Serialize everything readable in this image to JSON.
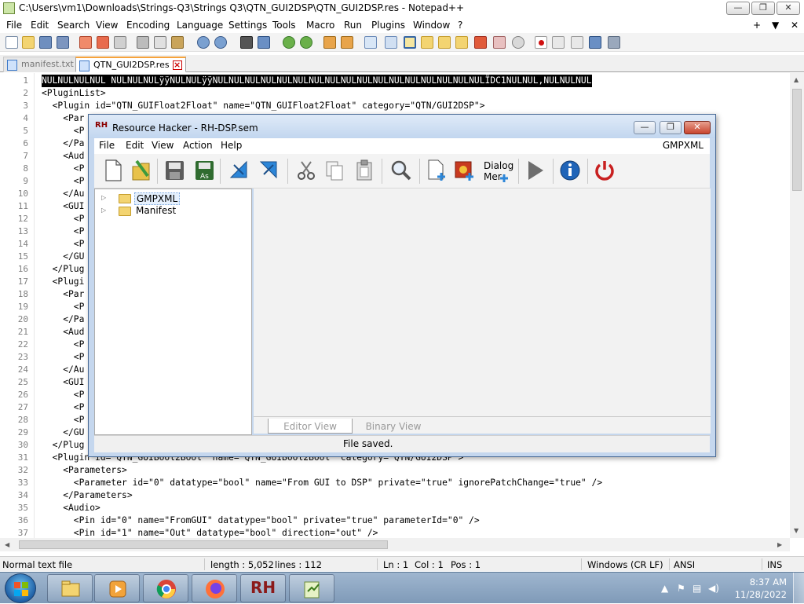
{
  "npp": {
    "title": "C:\\Users\\vm1\\Downloads\\Strings-Q3\\Strings Q3\\QTN_GUI2DSP\\QTN_GUI2DSP.res - Notepad++",
    "menu": [
      "File",
      "Edit",
      "Search",
      "View",
      "Encoding",
      "Language",
      "Settings",
      "Tools",
      "Macro",
      "Run",
      "Plugins",
      "Window",
      "?"
    ],
    "menu_right": [
      "+",
      "▼",
      "✕"
    ],
    "caption": {
      "minimize": "—",
      "maximize": "❐",
      "close": "✕"
    },
    "tabs": [
      {
        "label": "manifest.txt",
        "active": false
      },
      {
        "label": "QTN_GUI2DSP.res",
        "active": true
      }
    ],
    "lines": [
      {
        "n": "1",
        "t": "NULNULNULNUL NULNULNULÿÿNULNULÿÿNULNULNULNULNULNULNULNULNULNULNULNULNULNULNULNULNULÏDC1NULNUL,NULNULNUL"
      },
      {
        "n": "2",
        "t": "<PluginList>"
      },
      {
        "n": "3",
        "t": "  <Plugin id=\"QTN_GUIFloat2Float\" name=\"QTN_GUIFloat2Float\" category=\"QTN/GUI2DSP\">"
      },
      {
        "n": "4",
        "t": "    <Par"
      },
      {
        "n": "5",
        "t": "      <P"
      },
      {
        "n": "6",
        "t": "    </Pa"
      },
      {
        "n": "7",
        "t": "    <Aud"
      },
      {
        "n": "8",
        "t": "      <P"
      },
      {
        "n": "9",
        "t": "      <P"
      },
      {
        "n": "10",
        "t": "    </Au"
      },
      {
        "n": "11",
        "t": "    <GUI"
      },
      {
        "n": "12",
        "t": "      <P"
      },
      {
        "n": "13",
        "t": "      <P"
      },
      {
        "n": "14",
        "t": "      <P"
      },
      {
        "n": "15",
        "t": "    </GU"
      },
      {
        "n": "16",
        "t": "  </Plug"
      },
      {
        "n": "17",
        "t": "  <Plugi"
      },
      {
        "n": "18",
        "t": "    <Par"
      },
      {
        "n": "19",
        "t": "      <P"
      },
      {
        "n": "20",
        "t": "    </Pa"
      },
      {
        "n": "21",
        "t": "    <Aud"
      },
      {
        "n": "22",
        "t": "      <P"
      },
      {
        "n": "23",
        "t": "      <P"
      },
      {
        "n": "24",
        "t": "    </Au"
      },
      {
        "n": "25",
        "t": "    <GUI"
      },
      {
        "n": "26",
        "t": "      <P"
      },
      {
        "n": "27",
        "t": "      <P"
      },
      {
        "n": "28",
        "t": "      <P"
      },
      {
        "n": "29",
        "t": "    </GU"
      },
      {
        "n": "30",
        "t": "  </Plug"
      },
      {
        "n": "31",
        "t": "  <Plugin id=\"QTN_GUIBool2Bool\" name=\"QTN_GUIBool2Bool\" category=\"QTN/GUI2DSP\">"
      },
      {
        "n": "32",
        "t": "    <Parameters>"
      },
      {
        "n": "33",
        "t": "      <Parameter id=\"0\" datatype=\"bool\" name=\"From GUI to DSP\" private=\"true\" ignorePatchChange=\"true\" />"
      },
      {
        "n": "34",
        "t": "    </Parameters>"
      },
      {
        "n": "35",
        "t": "    <Audio>"
      },
      {
        "n": "36",
        "t": "      <Pin id=\"0\" name=\"FromGUI\" datatype=\"bool\" private=\"true\" parameterId=\"0\" />"
      },
      {
        "n": "37",
        "t": "      <Pin id=\"1\" name=\"Out\" datatype=\"bool\" direction=\"out\" />"
      }
    ],
    "status": {
      "type": "Normal text file",
      "length": "length : 5,052",
      "lines": "lines : 112",
      "ln": "Ln : 1",
      "col": "Col : 1",
      "pos": "Pos : 1",
      "eol": "Windows (CR LF)",
      "enc": "ANSI",
      "mode": "INS"
    }
  },
  "rh": {
    "icon": "RH",
    "title": "Resource Hacker - RH-DSP.sem",
    "menu": [
      "File",
      "Edit",
      "View",
      "Action",
      "Help"
    ],
    "menu_right": "GMPXML",
    "toolbar_dialog_label_1": "Dialog",
    "toolbar_dialog_label_2": "Mer",
    "tree": [
      {
        "label": "GMPXML",
        "selected": true
      },
      {
        "label": "Manifest",
        "selected": false
      }
    ],
    "tabs": [
      "Editor View",
      "Binary View"
    ],
    "status": "File saved."
  },
  "taskbar": {
    "time": "8:37 AM",
    "date": "11/28/2022",
    "rh_label": "RH"
  },
  "colors": {
    "accent_tab": "#f6a33c",
    "taskbar": "#8aa5c2",
    "rh_frame": "#c5d7ee",
    "close_red": "#c8452e"
  }
}
